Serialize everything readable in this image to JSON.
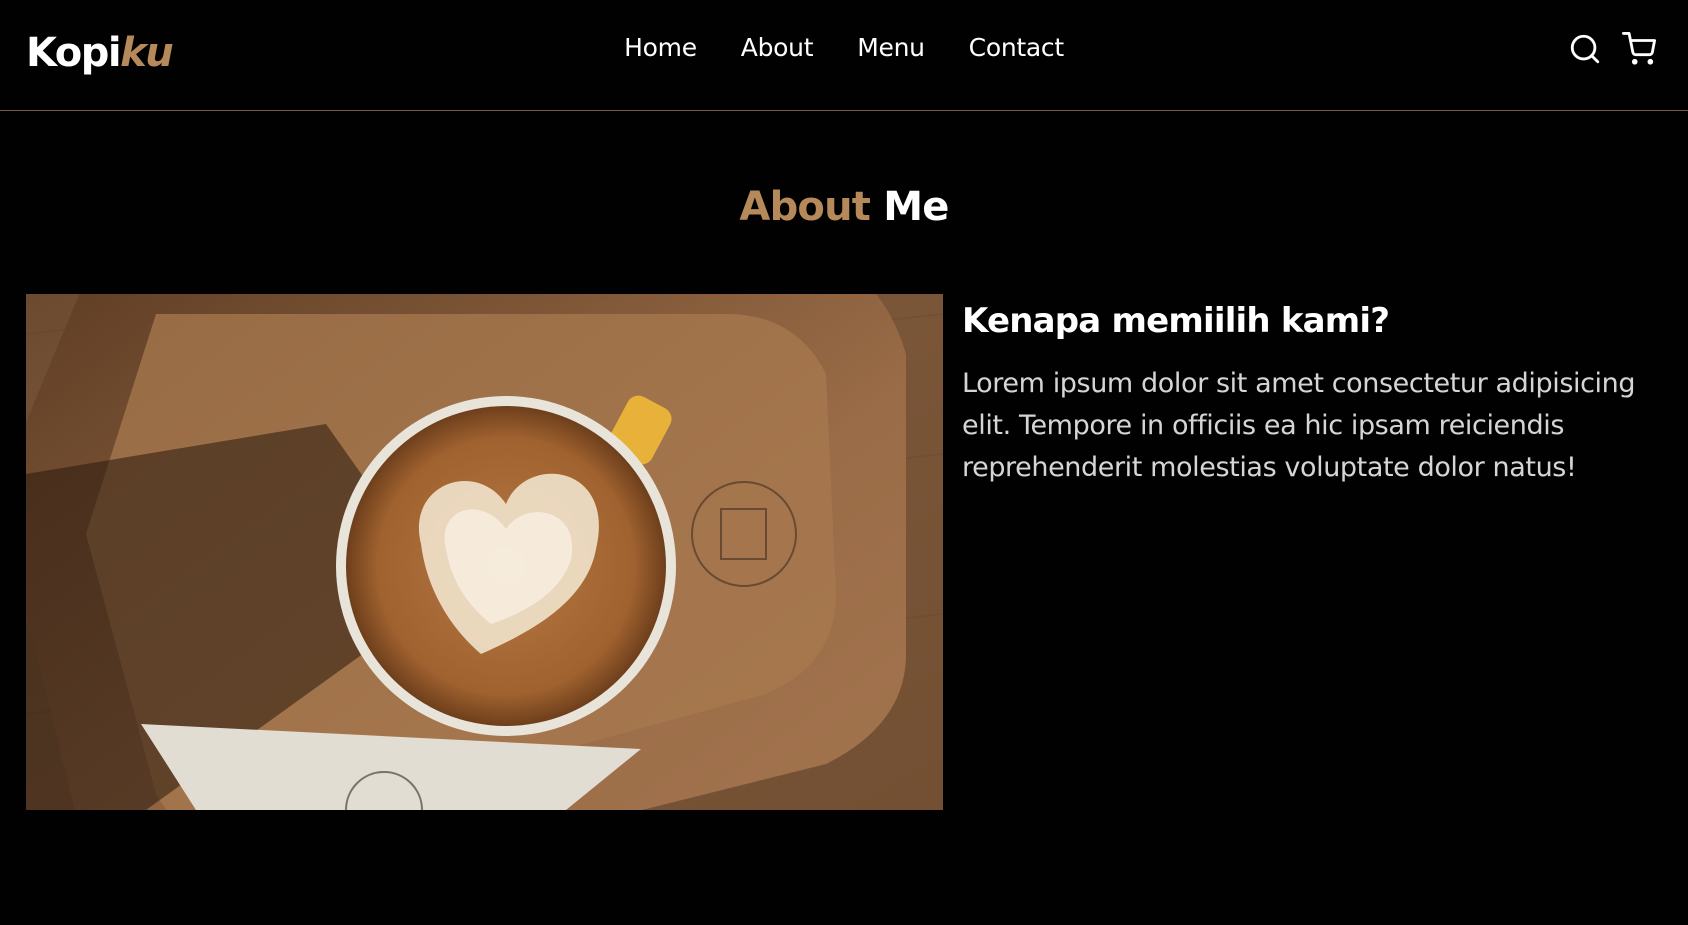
{
  "brand": {
    "name_main": "Kopi",
    "name_accent": "ku"
  },
  "nav": {
    "links": [
      {
        "label": "Home"
      },
      {
        "label": "About"
      },
      {
        "label": "Menu"
      },
      {
        "label": "Contact"
      }
    ],
    "icons": [
      "search-icon",
      "shopping-cart-icon"
    ]
  },
  "about": {
    "title_accent": "About",
    "title_rest": "Me",
    "heading": "Kenapa memiilih kami?",
    "body": "Lorem ipsum dolor sit amet consectetur adipisicing elit. Tempore in officiis ea hic ipsam reiciendis reprehenderit molestias voluptate dolor natus!",
    "image": "latte-art-coffee-photo"
  },
  "colors": {
    "background": "#010101",
    "accent": "#b6895b",
    "text": "#ffffff",
    "divider": "#7a5f45"
  }
}
